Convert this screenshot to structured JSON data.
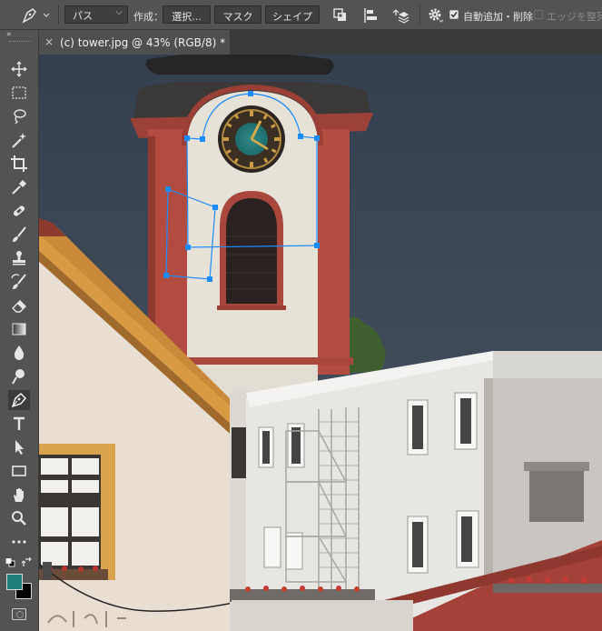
{
  "options_bar": {
    "tool_icon": "pen-tool-icon",
    "mode_value": "パス",
    "make_label": "作成：",
    "make_selection_button": "選択...",
    "make_mask_button": "マスク",
    "make_shape_button": "シェイプ",
    "path_operations_icon": "path-operations-icon",
    "path_alignment_icon": "path-alignment-icon",
    "path_arrangement_icon": "path-arrangement-icon",
    "settings_icon": "gear-icon",
    "auto_add_delete_label": "自動追加・削除",
    "auto_add_delete_checked": true,
    "align_edges_label": "エッジを整列",
    "align_edges_checked": false
  },
  "document_tab": {
    "title": "(c) tower.jpg @ 43% (RGB/8) *"
  },
  "toolbar": {
    "tools": [
      {
        "name": "move-tool-icon"
      },
      {
        "name": "rectangular-marquee-tool-icon"
      },
      {
        "name": "lasso-tool-icon"
      },
      {
        "name": "magic-wand-tool-icon"
      },
      {
        "name": "crop-tool-icon"
      },
      {
        "name": "eyedropper-tool-icon"
      },
      {
        "name": "healing-brush-tool-icon"
      },
      {
        "name": "brush-tool-icon"
      },
      {
        "name": "clone-stamp-tool-icon"
      },
      {
        "name": "history-brush-tool-icon"
      },
      {
        "name": "eraser-tool-icon"
      },
      {
        "name": "gradient-tool-icon"
      },
      {
        "name": "blur-tool-icon"
      },
      {
        "name": "dodge-tool-icon"
      },
      {
        "name": "pen-tool-icon",
        "active": true
      },
      {
        "name": "type-tool-icon"
      },
      {
        "name": "path-selection-tool-icon"
      },
      {
        "name": "rectangle-tool-icon"
      },
      {
        "name": "hand-tool-icon"
      },
      {
        "name": "zoom-tool-icon"
      },
      {
        "name": "more-tools-icon"
      }
    ],
    "foreground_color": "#1f7f78",
    "background_color": "#000000"
  },
  "colors": {
    "path_anchor": "#1a8cff",
    "panel": "#535353",
    "sky": "#3a4654"
  }
}
